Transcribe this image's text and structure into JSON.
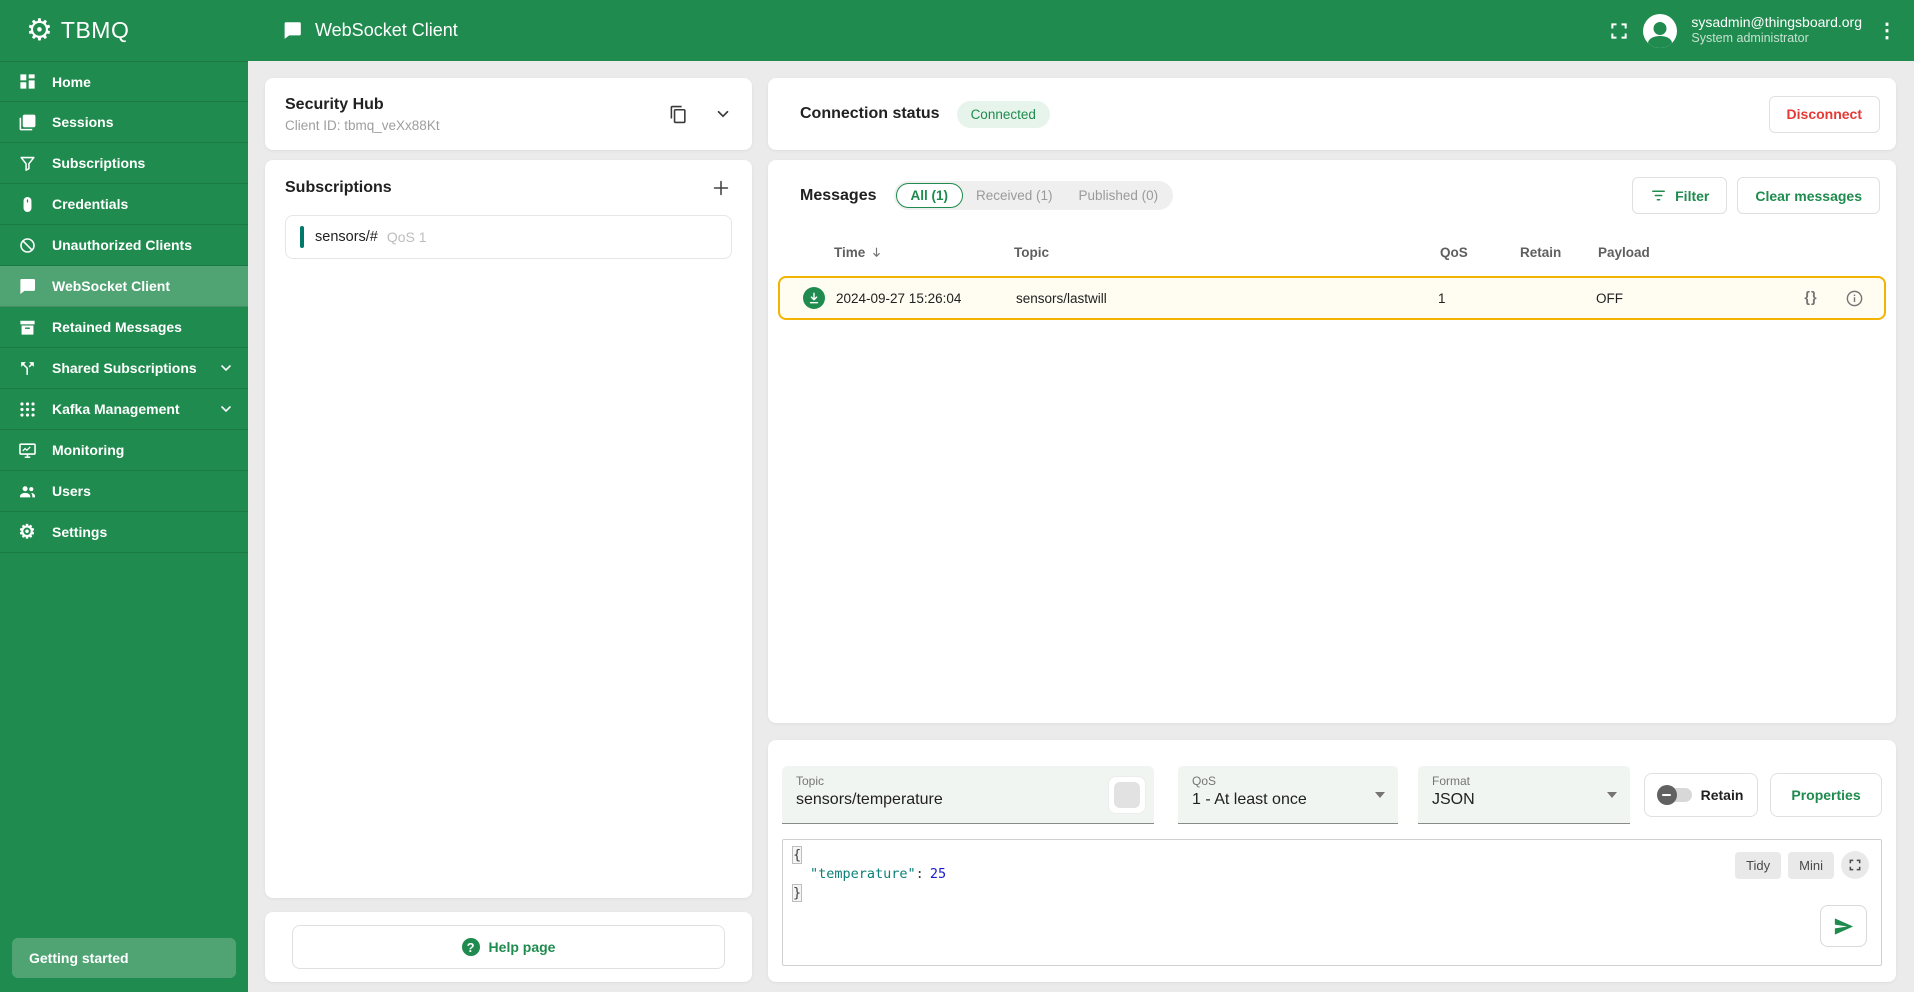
{
  "colors": {
    "primary": "#1f8b4e",
    "danger": "#e53935",
    "row_highlight_border": "#f2b400",
    "connected_badge_bg": "#e7f4ec",
    "subscription_bar": "#00796b"
  },
  "sidebar": {
    "logo_text": "TBMQ",
    "items": [
      {
        "label": "Home"
      },
      {
        "label": "Sessions"
      },
      {
        "label": "Subscriptions"
      },
      {
        "label": "Credentials"
      },
      {
        "label": "Unauthorized Clients"
      },
      {
        "label": "WebSocket Client",
        "active": true
      },
      {
        "label": "Retained Messages"
      },
      {
        "label": "Shared Subscriptions",
        "expandable": true
      },
      {
        "label": "Kafka Management",
        "expandable": true
      },
      {
        "label": "Monitoring"
      },
      {
        "label": "Users"
      },
      {
        "label": "Settings"
      }
    ],
    "getting_started_label": "Getting started"
  },
  "header": {
    "title": "WebSocket Client",
    "user_email": "sysadmin@thingsboard.org",
    "user_role": "System administrator"
  },
  "security_hub": {
    "title": "Security Hub",
    "client_id": "Client ID: tbmq_veXx88Kt"
  },
  "subscriptions": {
    "title": "Subscriptions",
    "items": [
      {
        "topic": "sensors/#",
        "qos_label": "QoS 1"
      }
    ]
  },
  "help": {
    "label": "Help page"
  },
  "connection": {
    "title": "Connection status",
    "status": "Connected",
    "disconnect_label": "Disconnect"
  },
  "messages": {
    "title": "Messages",
    "tabs": [
      {
        "label": "All (1)",
        "active": true
      },
      {
        "label": "Received (1)"
      },
      {
        "label": "Published (0)"
      }
    ],
    "filter_label": "Filter",
    "clear_label": "Clear messages",
    "columns": [
      "Time",
      "Topic",
      "QoS",
      "Retain",
      "Payload"
    ],
    "json_viewer_label": "{}",
    "rows": [
      {
        "direction": "received",
        "time": "2024-09-27 15:26:04",
        "topic": "sensors/lastwill",
        "qos": "1",
        "retain": "",
        "payload": "OFF"
      }
    ]
  },
  "publish": {
    "topic_label": "Topic",
    "topic_value": "sensors/temperature",
    "qos_label": "QoS",
    "qos_value": "1 - At least once",
    "format_label": "Format",
    "format_value": "JSON",
    "retain_label": "Retain",
    "properties_label": "Properties",
    "editor": {
      "open": "{",
      "key": "\"temperature\"",
      "colon": ":",
      "value": "25",
      "close": "}",
      "tidy_label": "Tidy",
      "mini_label": "Mini"
    }
  }
}
